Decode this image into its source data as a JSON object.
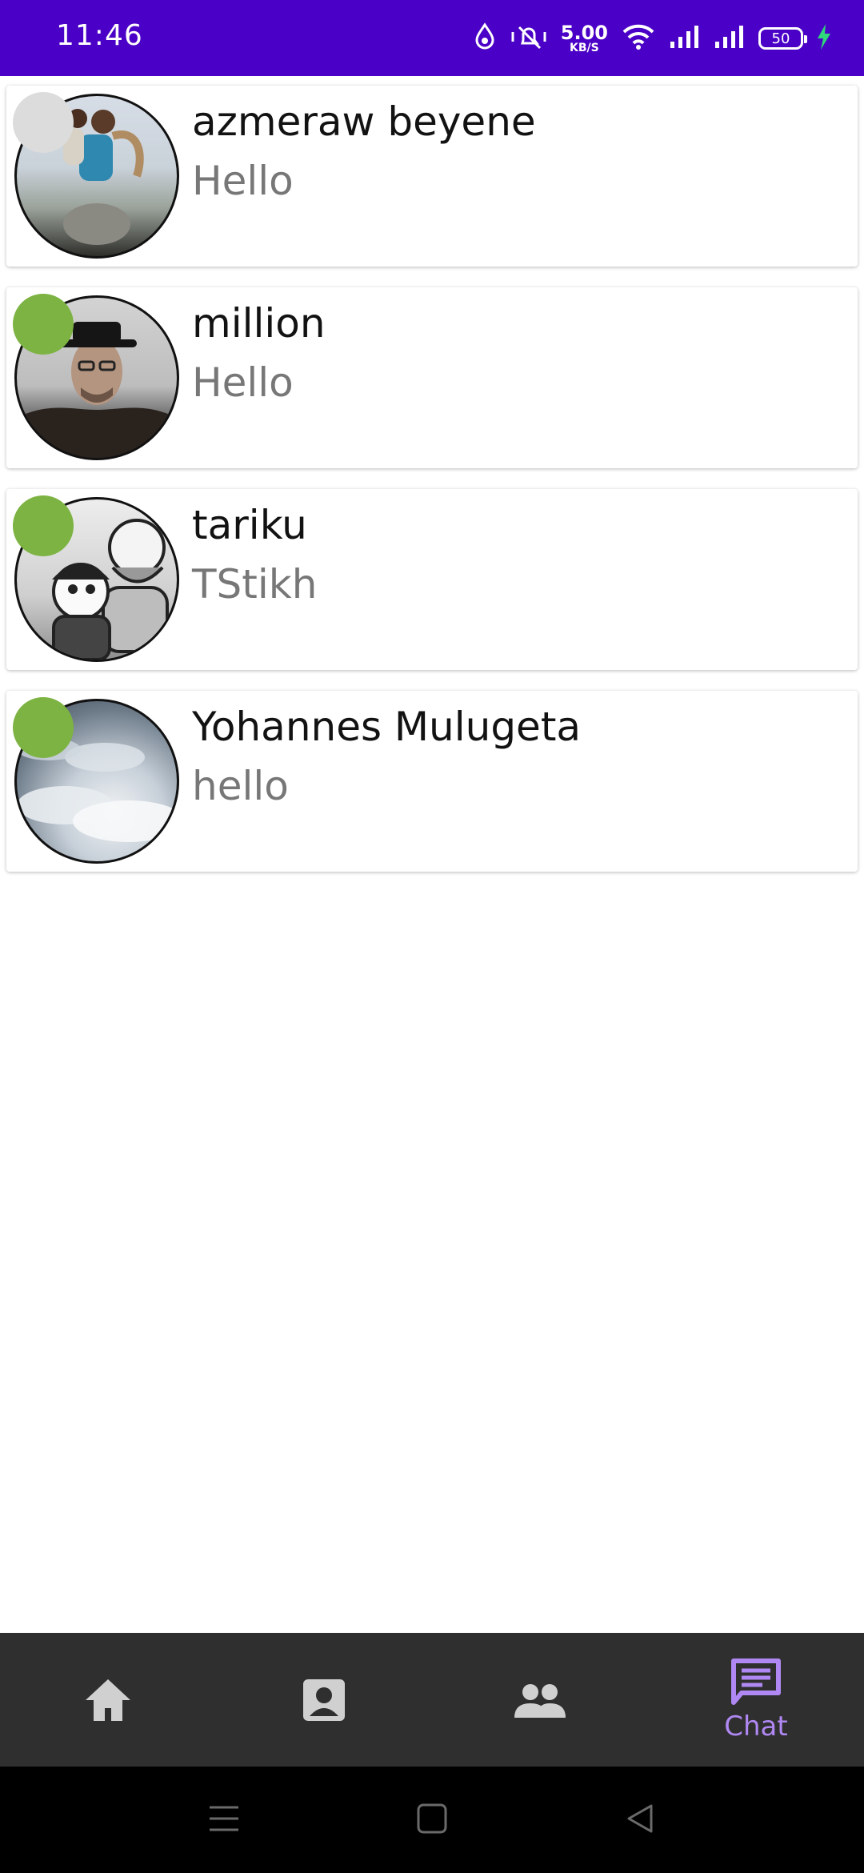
{
  "status_bar": {
    "time": "11:46",
    "net_speed_value": "5.00",
    "net_speed_unit": "KB/S",
    "battery_level": "50",
    "icons": [
      "data-saver-icon",
      "mute-vibrate-icon",
      "wifi-icon",
      "signal-icon",
      "signal-icon",
      "battery-icon",
      "charging-icon"
    ]
  },
  "chats": [
    {
      "name": "azmeraw beyene",
      "message": "Hello",
      "online": false
    },
    {
      "name": "million",
      "message": "Hello",
      "online": true
    },
    {
      "name": "tariku",
      "message": "TStikh",
      "online": true
    },
    {
      "name": "Yohannes Mulugeta",
      "message": "hello",
      "online": true
    }
  ],
  "bottom_nav": {
    "items": [
      {
        "icon": "home-icon",
        "label": ""
      },
      {
        "icon": "account-box-icon",
        "label": ""
      },
      {
        "icon": "people-icon",
        "label": ""
      },
      {
        "icon": "chat-icon",
        "label": "Chat"
      }
    ],
    "active_index": 3
  },
  "colors": {
    "status_bar": "#4a00c6",
    "online_dot": "#7cb342",
    "offline_dot": "#dcdcdc",
    "nav_background": "#2f2f2f",
    "nav_active": "#b088f3"
  }
}
